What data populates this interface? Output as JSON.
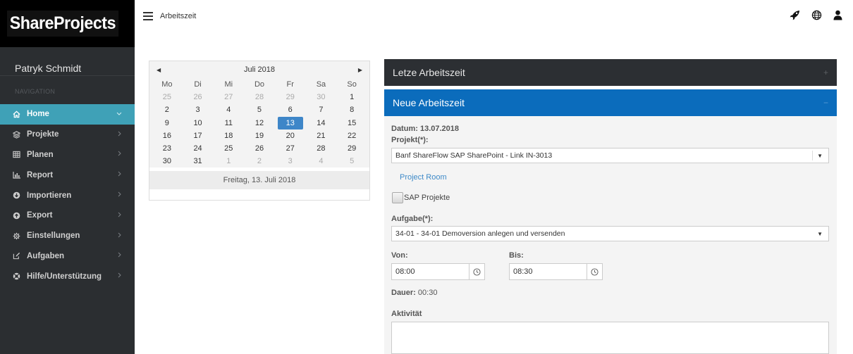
{
  "sidebar": {
    "logo": "ShareProjects",
    "user": "Patryk Schmidt",
    "nav_header": "NAVIGATION",
    "items": [
      {
        "label": "Home",
        "icon": "home-icon"
      },
      {
        "label": "Projekte",
        "icon": "layers-icon"
      },
      {
        "label": "Planen",
        "icon": "table-icon"
      },
      {
        "label": "Report",
        "icon": "bar-chart-icon"
      },
      {
        "label": "Importieren",
        "icon": "import-icon"
      },
      {
        "label": "Export",
        "icon": "export-icon"
      },
      {
        "label": "Einstellungen",
        "icon": "gear-icon"
      },
      {
        "label": "Aufgaben",
        "icon": "edit-icon"
      },
      {
        "label": "Hilfe/Unterstützung",
        "icon": "lifebuoy-icon"
      }
    ]
  },
  "topbar": {
    "title": "Arbeitszeit"
  },
  "calendar": {
    "month_label": "Juli 2018",
    "weekdays": [
      "Mo",
      "Di",
      "Mi",
      "Do",
      "Fr",
      "Sa",
      "So"
    ],
    "weeks": [
      [
        [
          "25",
          true
        ],
        [
          "26",
          true
        ],
        [
          "27",
          true
        ],
        [
          "28",
          true
        ],
        [
          "29",
          true
        ],
        [
          "30",
          true
        ],
        [
          "1",
          false
        ]
      ],
      [
        [
          "2",
          false
        ],
        [
          "3",
          false
        ],
        [
          "4",
          false
        ],
        [
          "5",
          false
        ],
        [
          "6",
          false
        ],
        [
          "7",
          false
        ],
        [
          "8",
          false
        ]
      ],
      [
        [
          "9",
          false
        ],
        [
          "10",
          false
        ],
        [
          "11",
          false
        ],
        [
          "12",
          false
        ],
        [
          "13",
          false
        ],
        [
          "14",
          false
        ],
        [
          "15",
          false
        ]
      ],
      [
        [
          "16",
          false
        ],
        [
          "17",
          false
        ],
        [
          "18",
          false
        ],
        [
          "19",
          false
        ],
        [
          "20",
          false
        ],
        [
          "21",
          false
        ],
        [
          "22",
          false
        ]
      ],
      [
        [
          "23",
          false
        ],
        [
          "24",
          false
        ],
        [
          "25",
          false
        ],
        [
          "26",
          false
        ],
        [
          "27",
          false
        ],
        [
          "28",
          false
        ],
        [
          "29",
          false
        ]
      ],
      [
        [
          "30",
          false
        ],
        [
          "31",
          false
        ],
        [
          "1",
          true
        ],
        [
          "2",
          true
        ],
        [
          "3",
          true
        ],
        [
          "4",
          true
        ],
        [
          "5",
          true
        ]
      ]
    ],
    "selected": "13",
    "footer": "Freitag, 13. Juli 2018"
  },
  "panels": {
    "last_title": "Letze Arbeitszeit",
    "last_toggle": "+",
    "new_title": "Neue Arbeitszeit",
    "new_toggle": "−"
  },
  "form": {
    "datum_label": "Datum:",
    "datum_value": "13.07.2018",
    "projekt_label": "Projekt(*):",
    "projekt_value": "Banf ShareFlow SAP SharePoint - Link IN-3013",
    "project_room": "Project Room",
    "sap_label": "SAP Projekte",
    "aufgabe_label": "Aufgabe(*):",
    "aufgabe_value": "34-01 - 34-01 Demoversion anlegen und versenden",
    "von_label": "Von:",
    "von_value": "08:00",
    "bis_label": "Bis:",
    "bis_value": "08:30",
    "dauer_label": "Dauer:",
    "dauer_value": "00:30",
    "aktivitaet_label": "Aktivität"
  },
  "colors": {
    "sidebar_bg": "#2b2e31",
    "active_nav": "#3fa1b7",
    "panel_dark": "#2c2f33",
    "panel_blue": "#0b6cbc",
    "selected_day": "#3e86c8"
  }
}
